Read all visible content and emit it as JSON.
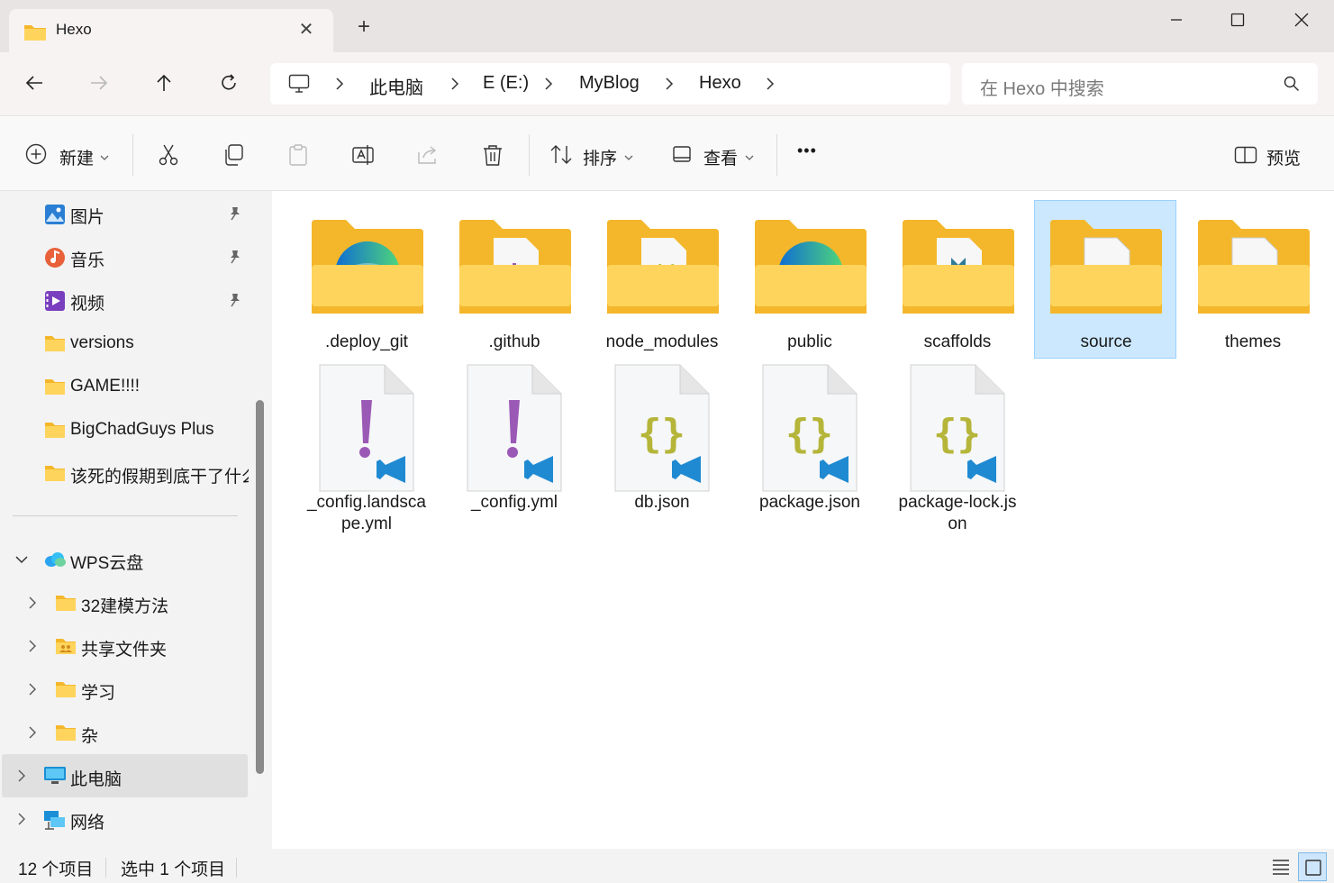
{
  "window": {
    "tab_title": "Hexo",
    "close_tab_glyph": "✕",
    "new_tab_glyph": "+"
  },
  "nav": {
    "breadcrumbs": [
      "此电脑",
      "E (E:)",
      "MyBlog",
      "Hexo"
    ],
    "search_placeholder": "在 Hexo 中搜索"
  },
  "toolbar": {
    "new_label": "新建",
    "sort_label": "排序",
    "view_label": "查看",
    "more_glyph": "•••",
    "preview_label": "预览"
  },
  "sidebar": {
    "quick": [
      {
        "label": "图片",
        "icon": "pictures-icon",
        "pinned": true
      },
      {
        "label": "音乐",
        "icon": "music-icon",
        "pinned": true
      },
      {
        "label": "视频",
        "icon": "videos-icon",
        "pinned": true
      },
      {
        "label": "versions",
        "icon": "folder-icon"
      },
      {
        "label": "GAME!!!!",
        "icon": "folder-icon"
      },
      {
        "label": "BigChadGuys Plus",
        "icon": "folder-icon"
      },
      {
        "label": "该死的假期到底干了什么",
        "icon": "folder-icon"
      }
    ],
    "cloud": {
      "label": "WPS云盘",
      "icon": "cloud-icon"
    },
    "cloud_children": [
      {
        "label": "32建模方法",
        "icon": "folder-icon"
      },
      {
        "label": "共享文件夹",
        "icon": "shared-folder-icon"
      },
      {
        "label": "学习",
        "icon": "folder-icon"
      },
      {
        "label": "杂",
        "icon": "folder-icon"
      }
    ],
    "this_pc": {
      "label": "此电脑",
      "icon": "monitor-icon"
    },
    "network": {
      "label": "网络",
      "icon": "network-icon"
    }
  },
  "content": {
    "folders": [
      {
        "name": ".deploy_git",
        "overlay": "edge"
      },
      {
        "name": ".github",
        "overlay": "exclaim"
      },
      {
        "name": "node_modules",
        "overlay": "braces"
      },
      {
        "name": "public",
        "overlay": "edge"
      },
      {
        "name": "scaffolds",
        "overlay": "markdown"
      },
      {
        "name": "source",
        "overlay": "blank",
        "selected": true
      },
      {
        "name": "themes",
        "overlay": "blank"
      }
    ],
    "files": [
      {
        "name": "_config.landscape.yml",
        "display": [
          "_config.landsca",
          "pe.yml"
        ],
        "glyph": "!",
        "glyph_color": "#9b59b6"
      },
      {
        "name": "_config.yml",
        "display": [
          "_config.yml"
        ],
        "glyph": "!",
        "glyph_color": "#9b59b6"
      },
      {
        "name": "db.json",
        "display": [
          "db.json"
        ],
        "glyph": "{ }",
        "glyph_color": "#b5b53a"
      },
      {
        "name": "package.json",
        "display": [
          "package.json"
        ],
        "glyph": "{ }",
        "glyph_color": "#b5b53a"
      },
      {
        "name": "package-lock.json",
        "display": [
          "package-lock.js",
          "on"
        ],
        "glyph": "{ }",
        "glyph_color": "#b5b53a"
      }
    ]
  },
  "status": {
    "count": "12 个项目",
    "selection": "选中 1 个项目"
  },
  "colors": {
    "selection_bg": "#cce8ff",
    "folder_back": "#f4b72b",
    "folder_front": "#ffd45c",
    "vscode_blue": "#1f8ad2"
  }
}
